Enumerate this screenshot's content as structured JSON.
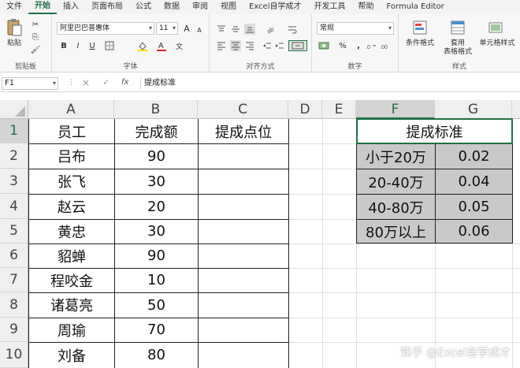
{
  "menu": [
    "文件",
    "开始",
    "插入",
    "页面布局",
    "公式",
    "数据",
    "审阅",
    "视图",
    "Excel自学成才",
    "开发工具",
    "帮助",
    "Formula Editor"
  ],
  "menu_active": "开始",
  "ribbon": {
    "clipboard": {
      "paste": "粘贴",
      "label": "剪贴板"
    },
    "font": {
      "name": "阿里巴巴普惠体",
      "size": "11",
      "label": "字体",
      "bold": "B",
      "italic": "I",
      "underline": "U",
      "grow": "A",
      "shrink": "A"
    },
    "alignment": {
      "label": "对齐方式"
    },
    "number": {
      "format": "常规",
      "percent": "%",
      "comma": ",",
      "label": "数字"
    },
    "styles": {
      "conditional": "条件格式",
      "table": "套用\n表格格式",
      "cell": "单元格样式",
      "label": "样式"
    }
  },
  "formula_bar": {
    "name_box": "F1",
    "cancel": "×",
    "enter": "✓",
    "fx": "fx",
    "content": "提成标准"
  },
  "columns": [
    "A",
    "B",
    "C",
    "D",
    "E",
    "F",
    "G"
  ],
  "rows": [
    "1",
    "2",
    "3",
    "4",
    "5",
    "6",
    "7",
    "8",
    "9",
    "10"
  ],
  "cells": {
    "A": [
      "员工",
      "吕布",
      "张飞",
      "赵云",
      "黄忠",
      "貂蝉",
      "程咬金",
      "诸葛亮",
      "周瑜",
      "刘备"
    ],
    "B": [
      "完成额",
      "90",
      "30",
      "20",
      "30",
      "90",
      "10",
      "50",
      "70",
      "80"
    ],
    "C": [
      "提成点位"
    ],
    "F": [
      "提成标准",
      "小于20万",
      "20-40万",
      "40-80万",
      "80万以上"
    ],
    "G": [
      "0.02",
      "0.04",
      "0.05",
      "0.06"
    ]
  },
  "watermark": "知乎 @Excel自学成才"
}
